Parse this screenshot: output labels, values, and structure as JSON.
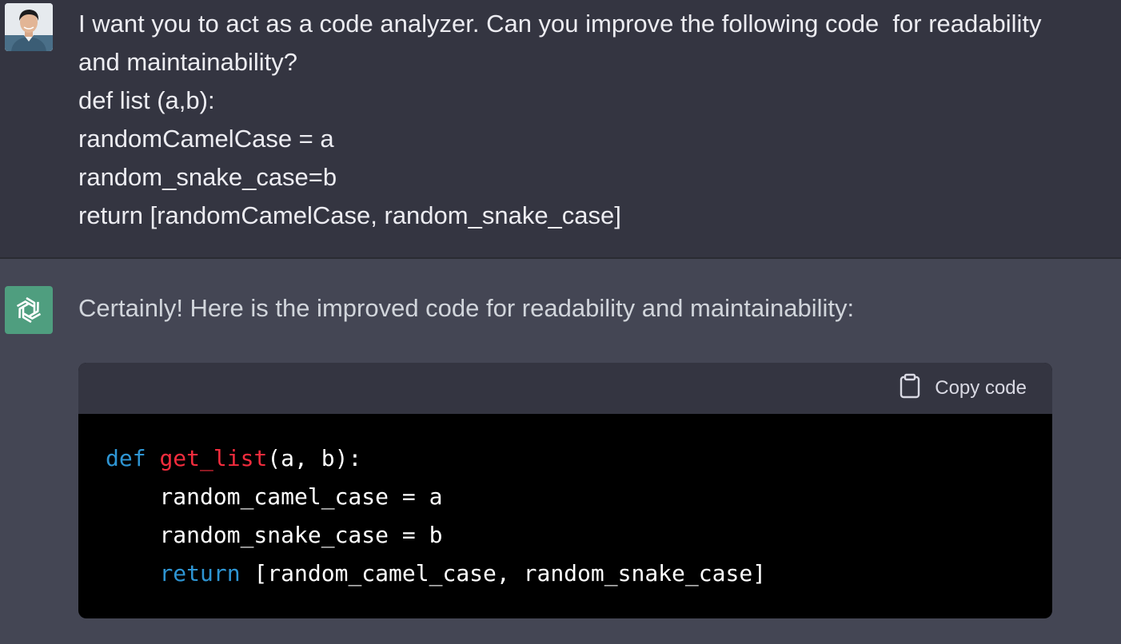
{
  "user_message": {
    "lines": [
      "I want you to act as a code analyzer. Can you improve the following code  for readability",
      "and maintainability?",
      "def list (a,b):",
      "randomCamelCase = a",
      "random_snake_case=b",
      "return [randomCamelCase, random_snake_case]"
    ]
  },
  "assistant_message": {
    "intro": "Certainly! Here is the improved code for readability and maintainability:",
    "code_block": {
      "copy_label": "Copy code",
      "line1": {
        "kw": "def",
        "fn": "get_list",
        "rest": "(a, b):"
      },
      "line2": "    random_camel_case = a",
      "line3": "    random_snake_case = b",
      "line4": {
        "indent": "    ",
        "kw": "return",
        "rest": " [random_camel_case, random_snake_case]"
      }
    }
  },
  "colors": {
    "user_bg": "#343541",
    "assistant_bg": "#444654",
    "code_bg": "#000000",
    "keyword": "#2e95d3",
    "function": "#f22c3d",
    "ai_avatar": "#4f9e7f"
  },
  "icons": [
    "user-avatar",
    "openai-logo-icon",
    "clipboard-icon"
  ]
}
